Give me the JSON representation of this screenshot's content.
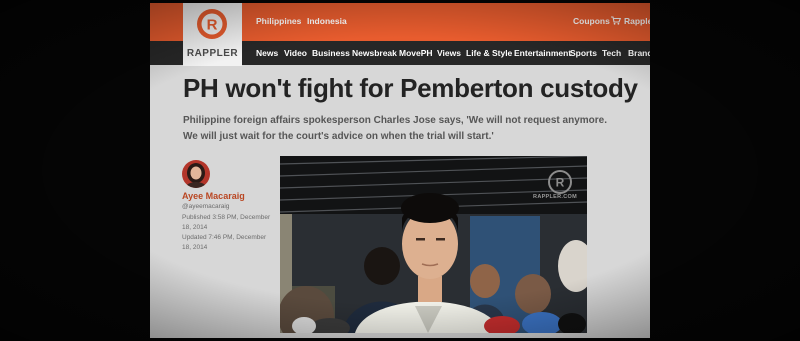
{
  "brand": {
    "name": "RAPPLER",
    "color": "#e85c2e"
  },
  "top_links": {
    "philippines": "Philippines",
    "indonesia": "Indonesia",
    "coupons": "Coupons",
    "cart_label": "Rappler"
  },
  "nav": {
    "items": [
      "News",
      "Video",
      "Business",
      "Newsbreak",
      "MovePH",
      "Views",
      "Life & Style",
      "Entertainment",
      "Sports",
      "Tech",
      "BrandRap"
    ]
  },
  "article": {
    "headline": "PH won't fight for Pemberton custody",
    "subhead": "Philippine foreign affairs spokesperson Charles Jose says, 'We will not request anymore. We will just wait for the court's advice on when the trial will start.'",
    "author_name": "Ayee Macaraig",
    "author_handle": "@ayeemacaraig",
    "published": "Published 3:58 PM, December 18, 2014",
    "updated": "Updated 7:46 PM, December 18, 2014"
  },
  "photo": {
    "watermark": "RAPPLER.COM"
  },
  "icons": {
    "logo": "rappler-logo-icon",
    "cart": "cart-icon",
    "watermark": "rappler-watermark-icon"
  }
}
